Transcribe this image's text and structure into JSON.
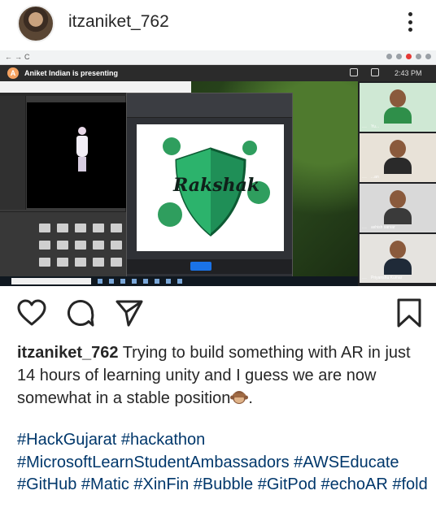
{
  "post": {
    "username": "itzaniket_762",
    "caption": " Trying to build something with AR in just 14 hours of learning unity and I guess we are now somewhat in a stable position",
    "caption_end": ".",
    "hashtags": "#HackGujarat #hackathon #MicrosoftLearnStudentAmbassadors #AWSEducate #GitHub #Matic #XinFin #Bubble #GitPod #echoAR #fold"
  },
  "meet": {
    "presenter_initial": "A",
    "presenting_text": "Aniket Indian is presenting",
    "clock": "2:43 PM",
    "logo_text": "Rakshak",
    "participants": [
      {
        "name": "Yu...",
        "shirt": "#2f8f4a",
        "bg": "#cfe8d4"
      },
      {
        "name": "...an",
        "shirt": "#2a2a2a",
        "bg": "#e8e2d8"
      },
      {
        "name": "ashish sarvar",
        "shirt": "#3a3a3a",
        "bg": "#d9d9d9"
      },
      {
        "name": "Priyanshu Kumar",
        "shirt": "#1f2a38",
        "bg": "#e5e3df"
      }
    ]
  },
  "colors": {
    "hashtag": "#00376b",
    "text": "#262626",
    "logo_green": "#2f9e5e"
  },
  "icons": [
    "more-options-icon",
    "heart-icon",
    "comment-icon",
    "share-icon",
    "bookmark-icon",
    "monkey-emoji-icon"
  ]
}
